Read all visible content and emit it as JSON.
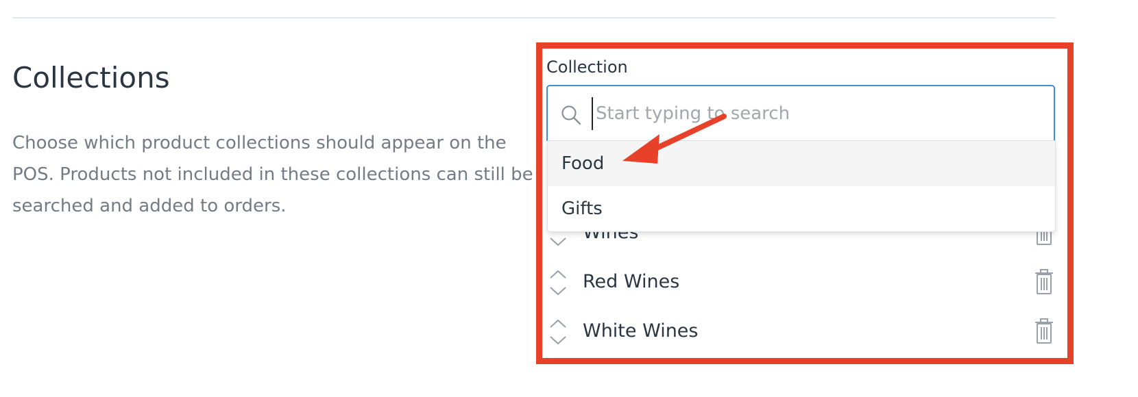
{
  "section": {
    "title": "Collections",
    "description": "Choose which product collections should appear on the POS. Products not included in these collections can still be searched and added to orders."
  },
  "collection_field": {
    "label": "Collection",
    "search_placeholder": "Start typing to search",
    "search_value": "",
    "search_icon": "search-icon"
  },
  "dropdown": {
    "options": [
      {
        "label": "Food",
        "highlighted": true
      },
      {
        "label": "Gifts",
        "highlighted": false
      }
    ]
  },
  "collections": [
    {
      "name": "Wines"
    },
    {
      "name": "Red Wines"
    },
    {
      "name": "White Wines"
    }
  ],
  "icons": {
    "sort": "sort-handle-icon",
    "delete": "trash-icon"
  },
  "colors": {
    "annotation": "#e8412a",
    "focus_border": "#3d8ed8",
    "muted_text": "#757b84",
    "heading_text": "#2a3642"
  }
}
